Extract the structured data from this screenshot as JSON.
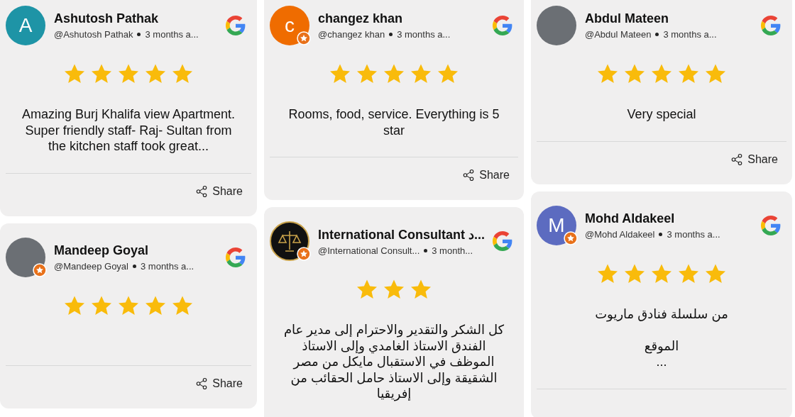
{
  "columns": [
    {
      "reviews": [
        {
          "name": "Ashutosh Pathak",
          "handle": "@Ashutosh Pathak",
          "time": "3 months a...",
          "avatar": {
            "kind": "letter",
            "letter": "A",
            "color": "#1e94a6"
          },
          "local_guide": false,
          "stars": 5,
          "text": "Amazing Burj Khalifa view Apartment.\nSuper friendly staff- Raj- Sultan from the kitchen staff took great...",
          "share": "Share"
        },
        {
          "name": "Mandeep Goyal",
          "handle": "@Mandeep Goyal",
          "time": "3 months a...",
          "avatar": {
            "kind": "photo"
          },
          "local_guide": true,
          "stars": 5,
          "share": "Share"
        }
      ]
    },
    {
      "reviews": [
        {
          "name": "changez khan",
          "handle": "@changez khan",
          "time": "3 months a...",
          "avatar": {
            "kind": "letter",
            "letter": "c",
            "color": "#ef6c00"
          },
          "local_guide": true,
          "stars": 5,
          "text": "Rooms, food, service. Everything is 5 star",
          "share": "Share"
        },
        {
          "name": "International Consultant د...",
          "handle": "@International Consult...",
          "time": "3 month...",
          "avatar": {
            "kind": "logo"
          },
          "local_guide": true,
          "stars": 3,
          "text": "كل الشكر والتقدير والاحترام إلى مدير عام الفندق الاستاذ الغامدي وإلى الاستاذ الموظف في الاستقبال مايكل من مصر الشقيقة وإلى الاستاذ حامل الحقائب من إفريقيا"
        }
      ]
    },
    {
      "reviews": [
        {
          "name": "Abdul Mateen",
          "handle": "@Abdul Mateen",
          "time": "3 months a...",
          "avatar": {
            "kind": "photo"
          },
          "local_guide": false,
          "stars": 5,
          "text": "Very special",
          "share": "Share"
        },
        {
          "name": "Mohd Aldakeel",
          "handle": "@Mohd Aldakeel",
          "time": "3 months a...",
          "avatar": {
            "kind": "letter",
            "letter": "M",
            "color": "#5c6bc0"
          },
          "local_guide": true,
          "stars": 5,
          "text": "من سلسلة فنادق ماريوت\n\nالموقع\n..."
        }
      ]
    }
  ]
}
